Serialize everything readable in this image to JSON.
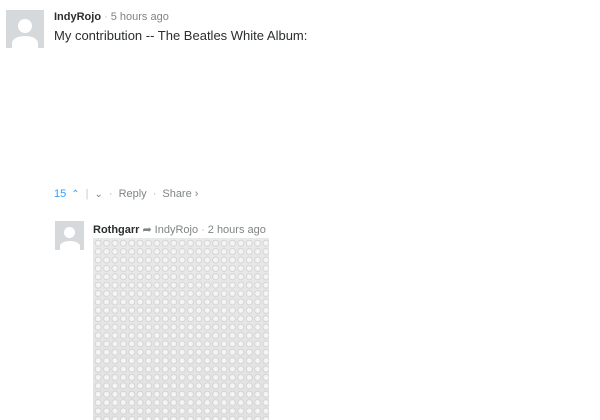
{
  "comment": {
    "author": "IndyRojo",
    "time": "5 hours ago",
    "text": "My contribution -- The Beatles White Album:",
    "actions": {
      "upvotes": "15",
      "reply_label": "Reply",
      "share_label": "Share ›"
    }
  },
  "reply": {
    "author": "Rothgarr",
    "parent": "IndyRojo",
    "time": "2 hours ago"
  },
  "icons": {
    "upvote": "chevron-up-icon",
    "downvote": "chevron-down-icon",
    "reply_to": "reply-arrow-icon"
  },
  "colors": {
    "accent": "#2e9fff",
    "muted": "#7f8486",
    "avatar_bg": "#d6d9db"
  }
}
